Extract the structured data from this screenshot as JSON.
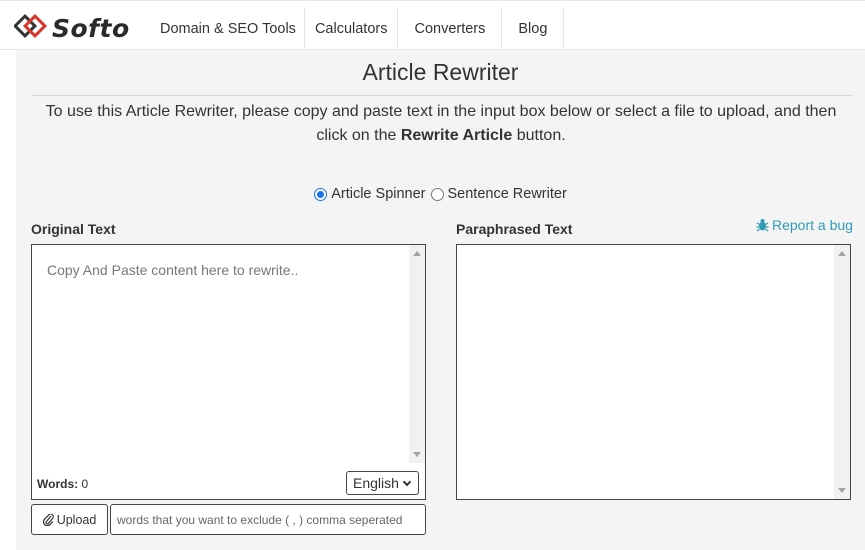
{
  "brand": {
    "name": "Softo",
    "accent": "#d9342b",
    "dark": "#333333"
  },
  "nav": {
    "items": [
      "Domain & SEO Tools",
      "Calculators",
      "Converters",
      "Blog"
    ]
  },
  "page": {
    "title": "Article Rewriter",
    "intro_before": "To use this Article Rewriter, please copy and paste text in the input box below or select a file to upload, and then click on the ",
    "intro_bold": "Rewrite Article",
    "intro_after": " button."
  },
  "modes": {
    "option1": "Article Spinner",
    "option2": "Sentence Rewriter",
    "selected": "Article Spinner"
  },
  "editor": {
    "original_label": "Original Text",
    "paraphrased_label": "Paraphrased Text",
    "report_bug": "Report a bug",
    "placeholder": "Copy And Paste content here to rewrite..",
    "words_label": "Words:",
    "words_count": "0",
    "language": "English",
    "upload_label": "Upload",
    "exclude_placeholder": "words that you want to exclude ( , ) comma seperated"
  },
  "colors": {
    "link": "#2f9bb5",
    "radio": "#1a73e8"
  }
}
